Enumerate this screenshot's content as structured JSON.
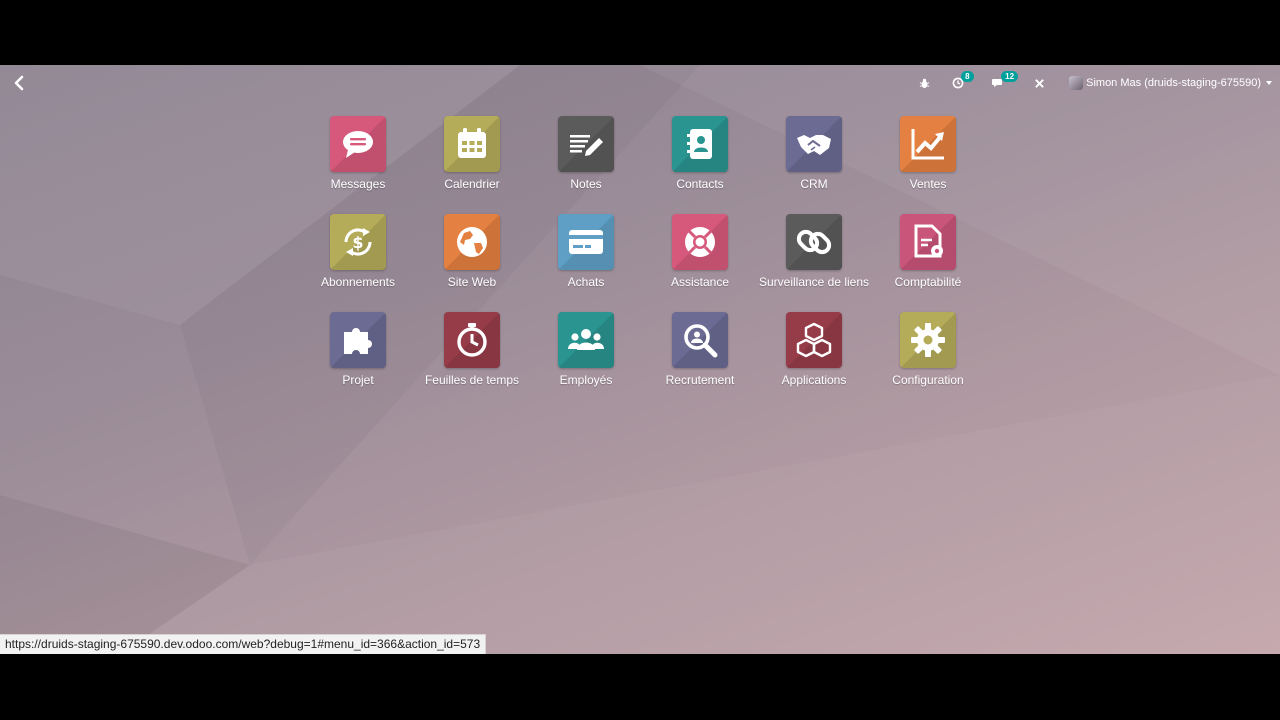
{
  "topbar": {
    "debug_icon": "bug-icon",
    "activity_count": "8",
    "messages_count": "12",
    "close_icon": "close-icon",
    "user_name": "Simon Mas (druids-staging-675590)"
  },
  "apps": [
    {
      "label": "Messages",
      "icon": "chat-bubble-icon",
      "color": "#d6597b"
    },
    {
      "label": "Calendrier",
      "icon": "calendar-icon",
      "color": "#b5ac5a"
    },
    {
      "label": "Notes",
      "icon": "notes-icon",
      "color": "#5b5b5b"
    },
    {
      "label": "Contacts",
      "icon": "contacts-book-icon",
      "color": "#2a9490"
    },
    {
      "label": "CRM",
      "icon": "handshake-icon",
      "color": "#6b6b93"
    },
    {
      "label": "Ventes",
      "icon": "trend-chart-icon",
      "color": "#e48041"
    },
    {
      "label": "Abonnements",
      "icon": "subscription-dollar-icon",
      "color": "#b5ac5a"
    },
    {
      "label": "Site Web",
      "icon": "globe-icon",
      "color": "#e48041"
    },
    {
      "label": "Achats",
      "icon": "credit-card-icon",
      "color": "#5f9fc5"
    },
    {
      "label": "Assistance",
      "icon": "lifebuoy-icon",
      "color": "#d6597b"
    },
    {
      "label": "Surveillance de liens",
      "icon": "link-icon",
      "color": "#5b5b5b"
    },
    {
      "label": "Comptabilité",
      "icon": "invoice-gear-icon",
      "color": "#c9557a"
    },
    {
      "label": "Projet",
      "icon": "puzzle-icon",
      "color": "#6b6b93"
    },
    {
      "label": "Feuilles de temps",
      "icon": "stopwatch-icon",
      "color": "#963c49"
    },
    {
      "label": "Employés",
      "icon": "team-icon",
      "color": "#2a9490"
    },
    {
      "label": "Recrutement",
      "icon": "magnifier-icon",
      "color": "#6b6b93"
    },
    {
      "label": "Applications",
      "icon": "cubes-icon",
      "color": "#963c49"
    },
    {
      "label": "Configuration",
      "icon": "gear-icon",
      "color": "#b5ac5a"
    }
  ],
  "status_bar": {
    "url": "https://druids-staging-675590.dev.odoo.com/web?debug=1#menu_id=366&action_id=573"
  }
}
